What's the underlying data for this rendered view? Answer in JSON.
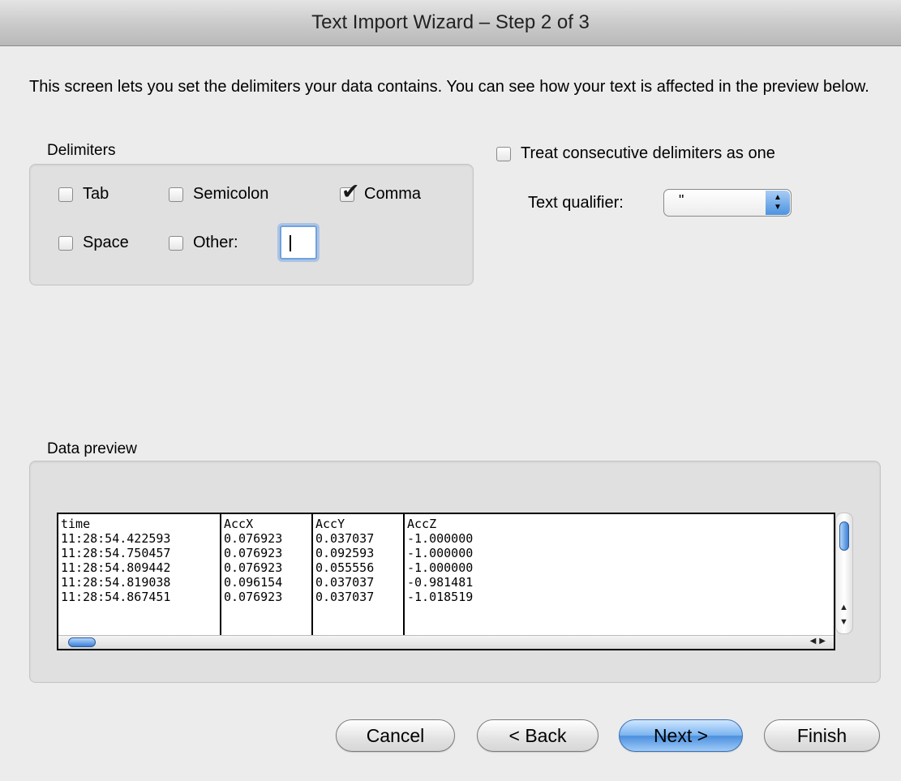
{
  "window": {
    "title": "Text Import Wizard – Step 2 of 3"
  },
  "intro": {
    "text": "This screen lets you set the delimiters your data contains.  You can see how your text is affected in the preview below."
  },
  "delimiters": {
    "label": "Delimiters",
    "tab": {
      "label": "Tab",
      "checked": false
    },
    "semicolon": {
      "label": "Semicolon",
      "checked": false
    },
    "comma": {
      "label": "Comma",
      "checked": true
    },
    "space": {
      "label": "Space",
      "checked": false
    },
    "other": {
      "label": "Other:",
      "checked": false,
      "value": ""
    }
  },
  "options": {
    "consecutive": {
      "label": "Treat consecutive delimiters as one",
      "checked": false
    },
    "qualifier": {
      "label": "Text qualifier:",
      "value": "\""
    }
  },
  "preview": {
    "label": "Data preview",
    "columns": [
      "time",
      "AccX",
      "AccY",
      "AccZ"
    ],
    "rows": [
      [
        "11:28:54.422593",
        "0.076923",
        "0.037037",
        "-1.000000"
      ],
      [
        "11:28:54.750457",
        "0.076923",
        "0.092593",
        "-1.000000"
      ],
      [
        "11:28:54.809442",
        "0.076923",
        "0.055556",
        "-1.000000"
      ],
      [
        "11:28:54.819038",
        "0.096154",
        "0.037037",
        "-0.981481"
      ],
      [
        "11:28:54.867451",
        "0.076923",
        "0.037037",
        "-1.018519"
      ]
    ]
  },
  "buttons": {
    "cancel": "Cancel",
    "back": "< Back",
    "next": "Next >",
    "finish": "Finish"
  },
  "colors": {
    "accent": "#4a8fde",
    "window_bg": "#ececec",
    "group_bg": "#e0e0e0"
  },
  "icons": {
    "check": "checkmark-icon",
    "select": "up-down-arrows-icon",
    "scroll_left": "arrow-left-icon",
    "scroll_right": "arrow-right-icon",
    "scroll_up": "arrow-up-icon",
    "scroll_down": "arrow-down-icon"
  }
}
